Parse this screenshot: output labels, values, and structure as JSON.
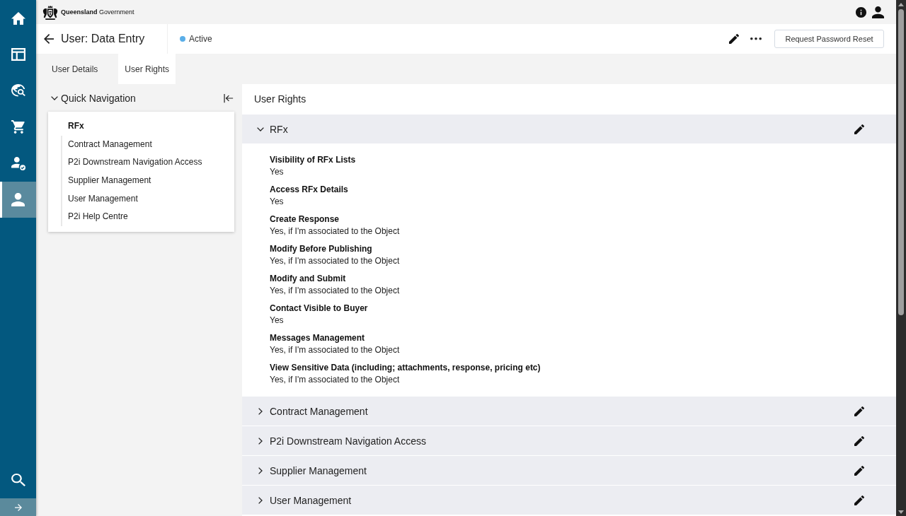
{
  "sidebar": {
    "items": [
      {
        "kind": "home",
        "selected": false
      },
      {
        "kind": "layout",
        "selected": false
      },
      {
        "kind": "globe_search",
        "selected": false
      },
      {
        "kind": "cart",
        "selected": false
      },
      {
        "kind": "user_check",
        "selected": false
      },
      {
        "kind": "user",
        "selected": true
      }
    ]
  },
  "header": {
    "logo_text": "**Queensland** Government"
  },
  "title_bar": {
    "title": "User: Data Entry",
    "status": "Active",
    "action_button": "Request Password Reset"
  },
  "tabs": [
    {
      "label": "User Details",
      "selected": false
    },
    {
      "label": "User Rights",
      "selected": true
    }
  ],
  "quick_navigation": {
    "title": "Quick Navigation",
    "expanded": true,
    "items": [
      {
        "label": "RFx",
        "selected": true
      },
      {
        "label": "Contract Management",
        "selected": false
      },
      {
        "label": "P2i Downstream Navigation Access",
        "selected": false
      },
      {
        "label": "Supplier Management",
        "selected": false
      },
      {
        "label": "User Management",
        "selected": false
      },
      {
        "label": "P2i Help Centre",
        "selected": false
      }
    ]
  },
  "user_rights": {
    "title": "User Rights",
    "sections": [
      {
        "title": "RFx",
        "expanded": true,
        "fields": [
          {
            "label": "Visibility of RFx Lists",
            "value": "Yes"
          },
          {
            "label": "Access RFx Details",
            "value": "Yes"
          },
          {
            "label": "Create Response",
            "value": "Yes, if I'm associated to the Object"
          },
          {
            "label": "Modify Before Publishing",
            "value": "Yes, if I'm associated to the Object"
          },
          {
            "label": "Modify and Submit",
            "value": "Yes, if I'm associated to the Object"
          },
          {
            "label": "Contact Visible to Buyer",
            "value": "Yes"
          },
          {
            "label": "Messages Management",
            "value": "Yes, if I'm associated to the Object"
          },
          {
            "label": "View Sensitive Data (including; attachments, response, pricing etc)",
            "value": "Yes, if I'm associated to the Object"
          }
        ]
      },
      {
        "title": "Contract Management",
        "expanded": false
      },
      {
        "title": "P2i Downstream Navigation Access",
        "expanded": false
      },
      {
        "title": "Supplier Management",
        "expanded": false
      },
      {
        "title": "User Management",
        "expanded": false
      }
    ]
  }
}
